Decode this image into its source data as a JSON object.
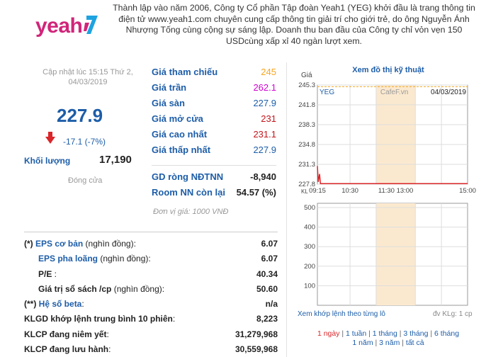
{
  "logo": {
    "text": "yeah",
    "mark": "1"
  },
  "intro": "Thành lập vào năm 2006, Công ty Cổ phần Tập đoàn Yeah1 (YEG) khởi đầu là trang thông tin điện tử www.yeah1.com chuyên cung cấp thông tin giải trí cho giới trẻ, do ông Nguyễn Ánh Nhượng Tống cùng cộng sự sáng lập. Doanh thu ban đầu của Công ty chỉ vỏn vẹn 150 USDcùng xấp xỉ 40 ngàn lượt xem.",
  "quote": {
    "updated": "Cập nhật lúc 15:15 Thứ 2, 04/03/2019",
    "price": "227.9",
    "change": "-17.1 (-7%)",
    "volume_label": "Khối lượng",
    "volume": "17,190",
    "status": "Đóng cửa"
  },
  "prices": [
    {
      "label": "Giá tham chiếu",
      "value": "245",
      "color": "#f5a623"
    },
    {
      "label": "Giá trần",
      "value": "262.1",
      "color": "#d100d1"
    },
    {
      "label": "Giá sàn",
      "value": "227.9",
      "color": "#1d5da8"
    },
    {
      "label": "Giá mở cửa",
      "value": "231",
      "color": "#c4161c"
    },
    {
      "label": "Giá cao nhất",
      "value": "231.1",
      "color": "#c4161c"
    },
    {
      "label": "Giá thấp nhất",
      "value": "227.9",
      "color": "#1d5da8"
    }
  ],
  "foreign": [
    {
      "label": "GD ròng NĐTNN",
      "value": "-8,940"
    },
    {
      "label": "Room NN còn lại",
      "value": "54.57 (%)"
    }
  ],
  "unit_note": "Đơn vị giá: 1000 VNĐ",
  "fundamentals": [
    {
      "prefix": "(*)",
      "label": "EPS cơ bản",
      "suffix": " (nghìn đồng):",
      "value": "6.07",
      "indent": false
    },
    {
      "prefix": "",
      "label": "EPS pha loãng",
      "suffix": " (nghìn đồng):",
      "value": "6.07",
      "indent": true
    },
    {
      "prefix": "",
      "label": "P/E",
      "suffix": " :",
      "value": "40.34",
      "indent": true
    },
    {
      "prefix": "",
      "label": "Giá trị sổ sách /cp",
      "suffix": " (nghìn đồng):",
      "value": "50.60",
      "indent": true
    },
    {
      "prefix": "(**)",
      "label": "Hệ số beta",
      "suffix": ":",
      "value": "n/a",
      "indent": false
    },
    {
      "prefix": "",
      "label": "KLGD khớp lệnh trung bình 10 phiên",
      "suffix": ":",
      "value": "8,223",
      "indent": false
    },
    {
      "prefix": "",
      "label": "KLCP đang niêm yết",
      "suffix": ":",
      "value": "31,279,968",
      "indent": false
    },
    {
      "prefix": "",
      "label": "KLCP đang lưu hành",
      "suffix": ":",
      "value": "30,559,968",
      "indent": false
    }
  ],
  "chart_title": "Xem đồ thị kỹ thuật",
  "chart_data": [
    {
      "type": "line",
      "ticker": "YEG",
      "source": "CafeF.vn",
      "date": "04/03/2019",
      "ylabel": "Giá",
      "yticks": [
        "245.3",
        "241.8",
        "238.3",
        "234.8",
        "231.3",
        "227.8"
      ],
      "ylim": [
        227.8,
        245.3
      ],
      "xticks": [
        "09:15",
        "10:30",
        "11:30 13:00",
        "15:00"
      ],
      "reference_price": 245,
      "series": [
        {
          "values": [
            {
              "t": "09:15",
              "v": 231
            },
            {
              "t": "09:17",
              "v": 228.2
            },
            {
              "t": "09:20",
              "v": 229.6
            },
            {
              "t": "09:22",
              "v": 227.9
            },
            {
              "t": "15:00",
              "v": 227.9
            }
          ]
        }
      ]
    },
    {
      "type": "bar",
      "ylabel": "KL",
      "yticks": [
        "500",
        "400",
        "300",
        "200",
        "100"
      ],
      "ylim": [
        0,
        500
      ],
      "values": []
    }
  ],
  "chart_note": "Xem khớp lệnh theo từng lô",
  "chart_unit": "đv KLg: 1 cp",
  "periods": [
    "1 ngày",
    "1 tuần",
    "1 tháng",
    "3 tháng",
    "6 tháng",
    "1 năm",
    "3 năm",
    "tất cả"
  ],
  "selected_period": "1 ngày"
}
